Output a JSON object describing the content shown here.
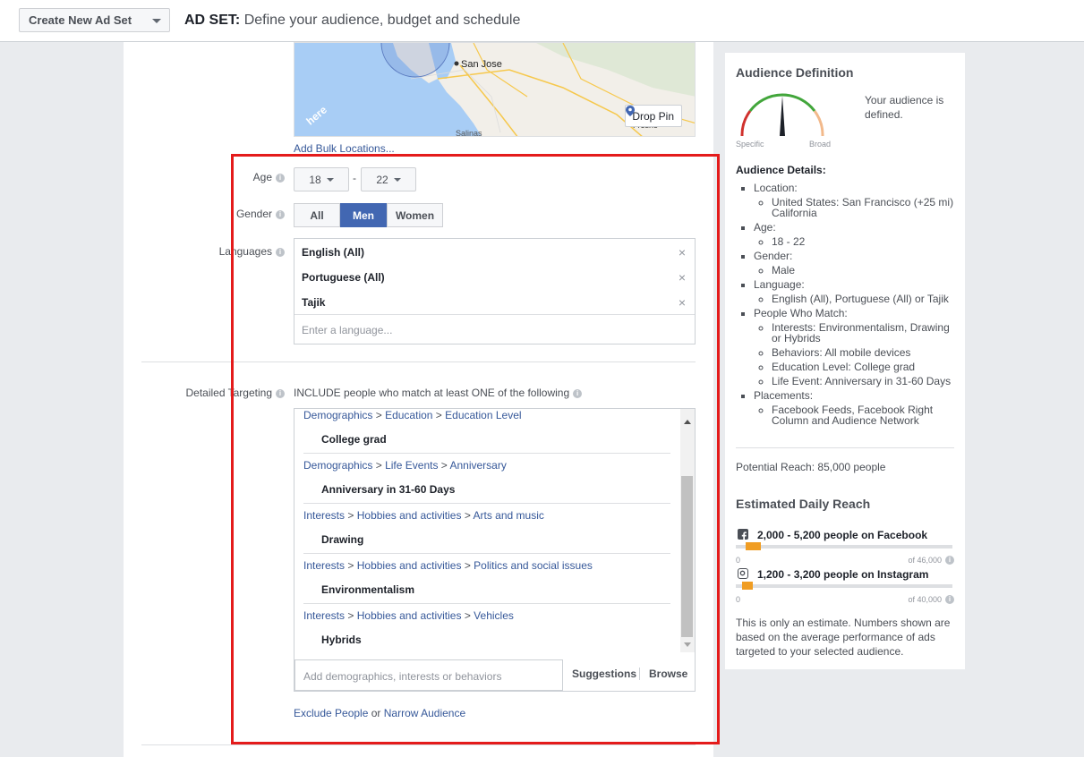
{
  "topbar": {
    "create_button": "Create New Ad Set",
    "title_prefix": "AD SET:",
    "title_text": "Define your audience, budget and schedule"
  },
  "map": {
    "city_label": "San Jose",
    "fresno_label": "Fresno",
    "salinas_label": "Salinas",
    "watermark": "here",
    "drop_pin": "Drop Pin",
    "bulk_link": "Add Bulk Locations..."
  },
  "age": {
    "label": "Age",
    "min": "18",
    "max": "22",
    "dash": "-"
  },
  "gender": {
    "label": "Gender",
    "options": [
      "All",
      "Men",
      "Women"
    ],
    "selected": "Men"
  },
  "languages": {
    "label": "Languages",
    "items": [
      "English (All)",
      "Portuguese (All)",
      "Tajik"
    ],
    "remove_glyph": "×",
    "placeholder": "Enter a language..."
  },
  "detailed_targeting": {
    "label": "Detailed Targeting",
    "include_text": "INCLUDE people who match at least ONE of the following",
    "groups": [
      {
        "path": [
          "Demographics",
          "Education",
          "Education Level"
        ],
        "item": "College grad"
      },
      {
        "path": [
          "Demographics",
          "Life Events",
          "Anniversary"
        ],
        "item": "Anniversary in 31-60 Days"
      },
      {
        "path": [
          "Interests",
          "Hobbies and activities",
          "Arts and music"
        ],
        "item": "Drawing"
      },
      {
        "path": [
          "Interests",
          "Hobbies and activities",
          "Politics and social issues"
        ],
        "item": "Environmentalism"
      },
      {
        "path": [
          "Interests",
          "Hobbies and activities",
          "Vehicles"
        ],
        "item": "Hybrids"
      }
    ],
    "path_separator": ">",
    "input_placeholder": "Add demographics, interests or behaviors",
    "suggestions": "Suggestions",
    "browse": "Browse",
    "exclude_link": "Exclude People",
    "or_text": "or",
    "narrow_link": "Narrow Audience"
  },
  "sidebar": {
    "title": "Audience Definition",
    "gauge_left": "Specific",
    "gauge_right": "Broad",
    "status": "Your audience is defined.",
    "details_heading": "Audience Details:",
    "details": [
      {
        "label": "Location:",
        "values": [
          "United States: San Francisco (+25 mi) California"
        ]
      },
      {
        "label": "Age:",
        "values": [
          "18 - 22"
        ]
      },
      {
        "label": "Gender:",
        "values": [
          "Male"
        ]
      },
      {
        "label": "Language:",
        "values": [
          "English (All), Portuguese (All) or Tajik"
        ]
      },
      {
        "label": "People Who Match:",
        "values": [
          "Interests: Environmentalism, Drawing or Hybrids",
          "Behaviors: All mobile devices",
          "Education Level: College grad",
          "Life Event: Anniversary in 31-60 Days"
        ]
      },
      {
        "label": "Placements:",
        "values": [
          "Facebook Feeds, Facebook Right Column and Audience Network"
        ]
      }
    ],
    "potential_reach": "Potential Reach: 85,000 people",
    "daily_reach_title": "Estimated Daily Reach",
    "facebook": {
      "text": "2,000 - 5,200 people on Facebook",
      "min": "0",
      "max": "of 46,000",
      "low": 2000,
      "high": 5200,
      "total": 46000
    },
    "instagram": {
      "text": "1,200 - 3,200 people on Instagram",
      "min": "0",
      "max": "of 40,000",
      "low": 1200,
      "high": 3200,
      "total": 40000
    },
    "estimate_note": "This is only an estimate. Numbers shown are based on the average performance of ads targeted to your selected audience."
  },
  "colors": {
    "accent": "#4267b2",
    "link": "#365899",
    "reach_bar": "#f09d23",
    "highlight_frame": "#e41b1b"
  }
}
